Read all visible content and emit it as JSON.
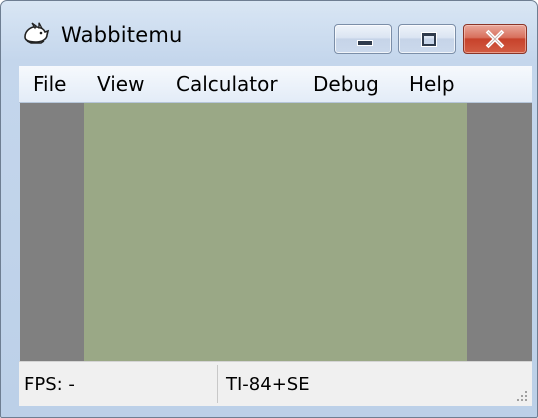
{
  "window": {
    "title": "Wabbitemu",
    "app_icon": "wabbit-icon",
    "controls": {
      "minimize": "minimize-icon",
      "maximize": "maximize-icon",
      "close": "close-icon"
    }
  },
  "menubar": {
    "items": [
      {
        "label": "File"
      },
      {
        "label": "View"
      },
      {
        "label": "Calculator"
      },
      {
        "label": "Debug"
      },
      {
        "label": "Help"
      }
    ]
  },
  "screen": {
    "lcd_color": "#9aa886",
    "bezel_color": "#808080"
  },
  "statusbar": {
    "fps": "FPS: -",
    "model": "TI-84+SE"
  }
}
